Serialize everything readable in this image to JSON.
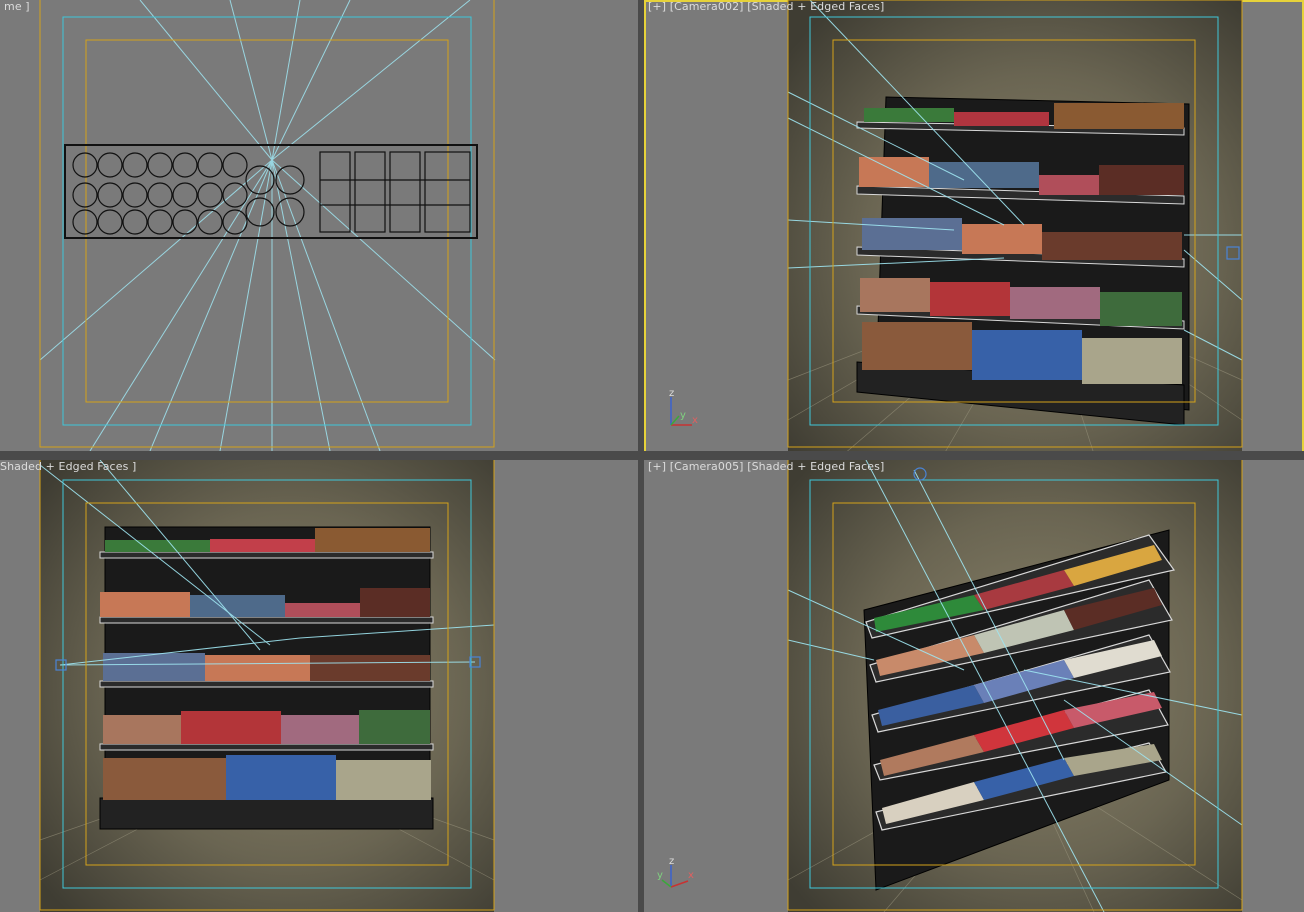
{
  "viewports": {
    "top_left": {
      "label": "me ]"
    },
    "top_right": {
      "plus": "[+]",
      "camera": "[Camera002]",
      "mode": "[Shaded + Edged Faces]"
    },
    "bottom_left": {
      "label": "Shaded + Edged Faces ]"
    },
    "bottom_right": {
      "plus": "[+]",
      "camera": "[Camera005]",
      "mode": "[Shaded + Edged Faces]"
    }
  },
  "axes": {
    "x": "x",
    "y": "y",
    "z": "z"
  },
  "colors": {
    "viewport_bg": "#7a7a7a",
    "safe_frame_outer": "#d4a21a",
    "safe_frame_cyan": "#3fc7d9",
    "active_border": "#e6d23a",
    "camera_bg_start": "#8b846b",
    "camera_bg_end": "#3a3a30"
  }
}
